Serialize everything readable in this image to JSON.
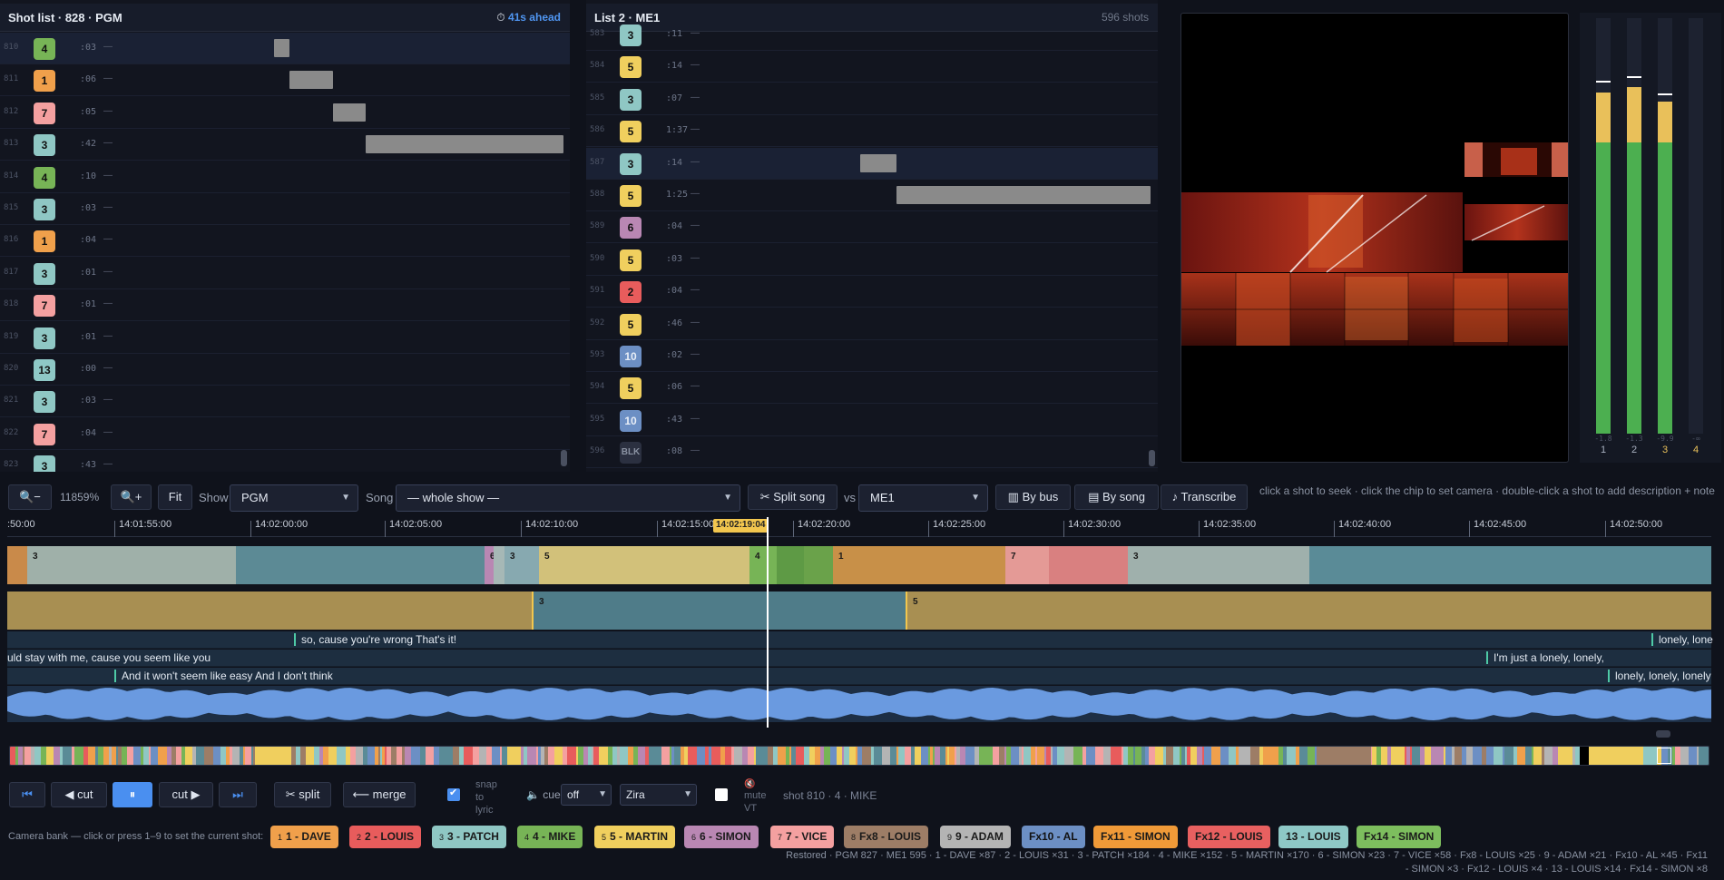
{
  "left_panel": {
    "title": "Shot list · 828 · PGM",
    "ahead": "41s ahead",
    "rows": [
      {
        "num": "810",
        "cam": "4",
        "dur": ":03",
        "dash": "—"
      },
      {
        "num": "811",
        "cam": "1",
        "dur": ":06",
        "dash": "—"
      },
      {
        "num": "812",
        "cam": "7",
        "dur": ":05",
        "dash": "—"
      },
      {
        "num": "813",
        "cam": "3",
        "dur": ":42",
        "dash": "—"
      },
      {
        "num": "814",
        "cam": "4",
        "dur": ":10",
        "dash": "—"
      },
      {
        "num": "815",
        "cam": "3",
        "dur": ":03",
        "dash": "—"
      },
      {
        "num": "816",
        "cam": "1",
        "dur": ":04",
        "dash": "—"
      },
      {
        "num": "817",
        "cam": "3",
        "dur": ":01",
        "dash": "—"
      },
      {
        "num": "818",
        "cam": "7",
        "dur": ":01",
        "dash": "—"
      },
      {
        "num": "819",
        "cam": "3",
        "dur": ":01",
        "dash": "—"
      },
      {
        "num": "820",
        "cam": "13",
        "dur": ":00",
        "dash": "—"
      },
      {
        "num": "821",
        "cam": "3",
        "dur": ":03",
        "dash": "—"
      },
      {
        "num": "822",
        "cam": "7",
        "dur": ":04",
        "dash": "—"
      },
      {
        "num": "823",
        "cam": "3",
        "dur": ":43",
        "dash": "—"
      }
    ]
  },
  "right_panel": {
    "title": "List 2 · ME1",
    "count": "596 shots",
    "rows": [
      {
        "num": "583",
        "cam": "3",
        "dur": ":11",
        "dash": "—"
      },
      {
        "num": "584",
        "cam": "5",
        "dur": ":14",
        "dash": "—"
      },
      {
        "num": "585",
        "cam": "3",
        "dur": ":07",
        "dash": "—"
      },
      {
        "num": "586",
        "cam": "5",
        "dur": "1:37",
        "dash": "—"
      },
      {
        "num": "587",
        "cam": "3",
        "dur": ":14",
        "dash": "—"
      },
      {
        "num": "588",
        "cam": "5",
        "dur": "1:25",
        "dash": "—"
      },
      {
        "num": "589",
        "cam": "6",
        "dur": ":04",
        "dash": "—"
      },
      {
        "num": "590",
        "cam": "5",
        "dur": ":03",
        "dash": "—"
      },
      {
        "num": "591",
        "cam": "2",
        "dur": ":04",
        "dash": "—"
      },
      {
        "num": "592",
        "cam": "5",
        "dur": ":46",
        "dash": "—"
      },
      {
        "num": "593",
        "cam": "10",
        "dur": ":02",
        "dash": "—"
      },
      {
        "num": "594",
        "cam": "5",
        "dur": ":06",
        "dash": "—"
      },
      {
        "num": "595",
        "cam": "10",
        "dur": ":43",
        "dash": "—"
      },
      {
        "num": "596",
        "cam": "BLK",
        "dur": ":08",
        "dash": "—"
      }
    ]
  },
  "meters": {
    "channels": [
      {
        "label": "1",
        "value": "-1.8",
        "level": 0.82,
        "peak": 0.845
      },
      {
        "label": "2",
        "value": "-1.3",
        "level": 0.835,
        "peak": 0.855
      },
      {
        "label": "3",
        "value": "-9.9",
        "level": 0.8,
        "peak": 0.815
      },
      {
        "label": "4",
        "value": "-∞",
        "level": 0,
        "peak": 0
      }
    ]
  },
  "toolbar": {
    "zoom_out": "🔍−",
    "zoom_level": "11859%",
    "zoom_in": "🔍+",
    "fit": "Fit",
    "show_label": "Show",
    "show_value": "PGM",
    "song_label": "Song",
    "song_value": "— whole show —",
    "split_song": "✂ Split song",
    "vs_label": "vs",
    "vs_value": "ME1",
    "by_bus": "▥ By bus",
    "by_song": "▤ By song",
    "transcribe": "♪ Transcribe",
    "hint": "click a shot to seek · click the chip to set camera · double-click a shot to add description + note"
  },
  "timeline": {
    "ticks": [
      ":50:00",
      "14:01:55:00",
      "14:02:00:00",
      "14:02:05:00",
      "14:02:10:00",
      "14:02:15:00",
      "14:02:20:00",
      "14:02:25:00",
      "14:02:30:00",
      "14:02:35:00",
      "14:02:40:00",
      "14:02:45:00",
      "14:02:50:00"
    ],
    "playhead_time": "14:02:19:04",
    "track1_labels": [
      "3",
      "6",
      "3",
      "5",
      "4",
      "1",
      "7",
      "3"
    ],
    "track2_labels": [
      "3",
      "5"
    ],
    "lyrics1": [
      "so, cause you're wrong That's it!",
      "lonely, lone"
    ],
    "lyrics2": [
      "uld stay with me, cause you seem like you",
      "I'm just a lonely, lonely,"
    ],
    "lyrics3": [
      "And it won't seem like easy And I don't think",
      "lonely, lonely, lonely"
    ]
  },
  "transport": {
    "prev": "⏮",
    "cut_back": "◀ cut",
    "pause": "⏸",
    "cut_fwd": "cut ▶",
    "next": "⏭",
    "split": "✂ split",
    "merge": "⟵ merge",
    "snap_label": "snap to lyric",
    "cue_label": "🔈 cue",
    "cue_value": "off",
    "voice_value": "Zira",
    "mute_icon": "🔇",
    "mute_label": "mute VT",
    "status": "shot 810 · 4 · MIKE"
  },
  "camera_bank": {
    "label": "Camera bank — click or press 1–9 to set the current shot:",
    "cams": [
      {
        "num": "1",
        "name": "1 - DAVE",
        "color": "#f0a04b"
      },
      {
        "num": "2",
        "name": "2 - LOUIS",
        "color": "#e85c5c"
      },
      {
        "num": "3",
        "name": "3 - PATCH",
        "color": "#8fc7c4"
      },
      {
        "num": "4",
        "name": "4 - MIKE",
        "color": "#77b456"
      },
      {
        "num": "5",
        "name": "5 - MARTIN",
        "color": "#f0cf5e"
      },
      {
        "num": "6",
        "name": "6 - SIMON",
        "color": "#b987b3"
      },
      {
        "num": "7",
        "name": "7 - VICE",
        "color": "#f4a0a0"
      },
      {
        "num": "8",
        "name": "Fx8 - LOUIS",
        "color": "#9d7d66"
      },
      {
        "num": "9",
        "name": "9 - ADAM",
        "color": "#b4b4b4"
      },
      {
        "num": "",
        "name": "Fx10 - AL",
        "color": "#6c8fc4"
      },
      {
        "num": "",
        "name": "Fx11 - SIMON",
        "color": "#f09a38"
      },
      {
        "num": "",
        "name": "Fx12 - LOUIS",
        "color": "#e86060"
      },
      {
        "num": "",
        "name": "13 - LOUIS",
        "color": "#8ec8c6"
      },
      {
        "num": "",
        "name": "Fx14 - SIMON",
        "color": "#7dbe5e"
      }
    ]
  },
  "restored": "Restored · PGM 827 · ME1 595 · 1 - DAVE ×87 · 2 - LOUIS ×31 · 3 - PATCH ×184 · 4 - MIKE ×152 · 5 - MARTIN ×170 · 6 - SIMON ×23 · 7 - VICE ×58 · Fx8 - LOUIS ×25 · 9 - ADAM ×21 · Fx10 - AL ×45 · Fx11 - SIMON ×3 · Fx12 - LOUIS ×4 · 13 - LOUIS ×14 · Fx14 - SIMON ×8",
  "colors": {
    "1": "#f0a04b",
    "2": "#e85c5c",
    "3": "#8fc7c4",
    "4": "#77b456",
    "5": "#f0cf5e",
    "6": "#b987b3",
    "7": "#f4a0a0",
    "10": "#6c8fc4",
    "13": "#8ec8c6",
    "BLK": "#2b3040",
    "accent": "#4a8ff0"
  }
}
